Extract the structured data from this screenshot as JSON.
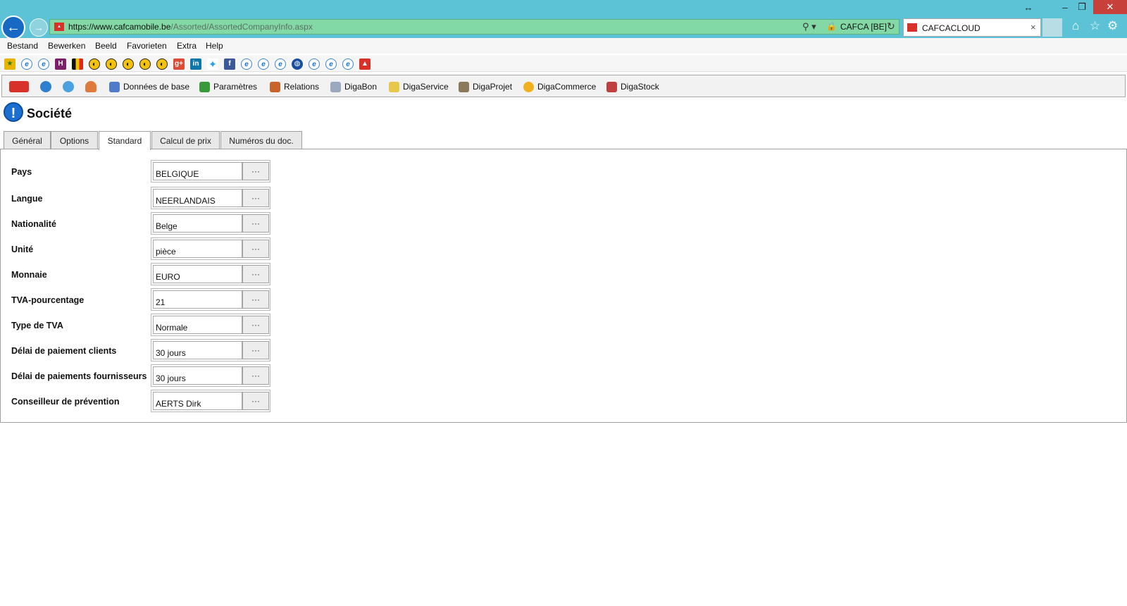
{
  "window": {
    "resize_glyph": "↔",
    "minimize_glyph": "–",
    "restore_glyph": "❐",
    "close_glyph": "✕"
  },
  "browser": {
    "url_host": "https://www.cafcamobile.be",
    "url_path": "/Assorted/AssortedCompanyInfo.aspx",
    "site_identity": "CAFCA [BE]",
    "tab_title": "CAFCACLOUD",
    "tab_close": "×",
    "icons": [
      "back-icon",
      "forward-icon",
      "search-icon",
      "lock-icon",
      "refresh-icon",
      "home-icon",
      "star-icon",
      "gear-icon"
    ]
  },
  "menubar": {
    "items": [
      "Bestand",
      "Bewerken",
      "Beeld",
      "Favorieten",
      "Extra",
      "Help"
    ]
  },
  "app_toolbar": {
    "items": [
      "Données de base",
      "Paramètres",
      "Relations",
      "DigaBon",
      "DigaService",
      "DigaProjet",
      "DigaCommerce",
      "DigaStock"
    ]
  },
  "page": {
    "title": "Société",
    "tabs": [
      "Général",
      "Options",
      "Standard",
      "Calcul de prix",
      "Numéros du doc."
    ],
    "active_tab": "Standard"
  },
  "form": {
    "rows": [
      {
        "label": "Pays",
        "value": "BELGIQUE"
      },
      {
        "label": "Langue",
        "value": "NEERLANDAIS"
      },
      {
        "label": "Nationalité",
        "value": "Belge"
      },
      {
        "label": "Unité",
        "value": "pièce"
      },
      {
        "label": "Monnaie",
        "value": "EURO"
      },
      {
        "label": "TVA-pourcentage",
        "value": "21"
      },
      {
        "label": "Type de TVA",
        "value": "Normale"
      },
      {
        "label": "Délai de paiement clients",
        "value": "30 jours"
      },
      {
        "label": "Délai de paiements fournisseurs",
        "value": "30 jours"
      },
      {
        "label": "Conseilleur de prévention",
        "value": "AERTS Dirk"
      }
    ],
    "more_button_label": "···"
  }
}
